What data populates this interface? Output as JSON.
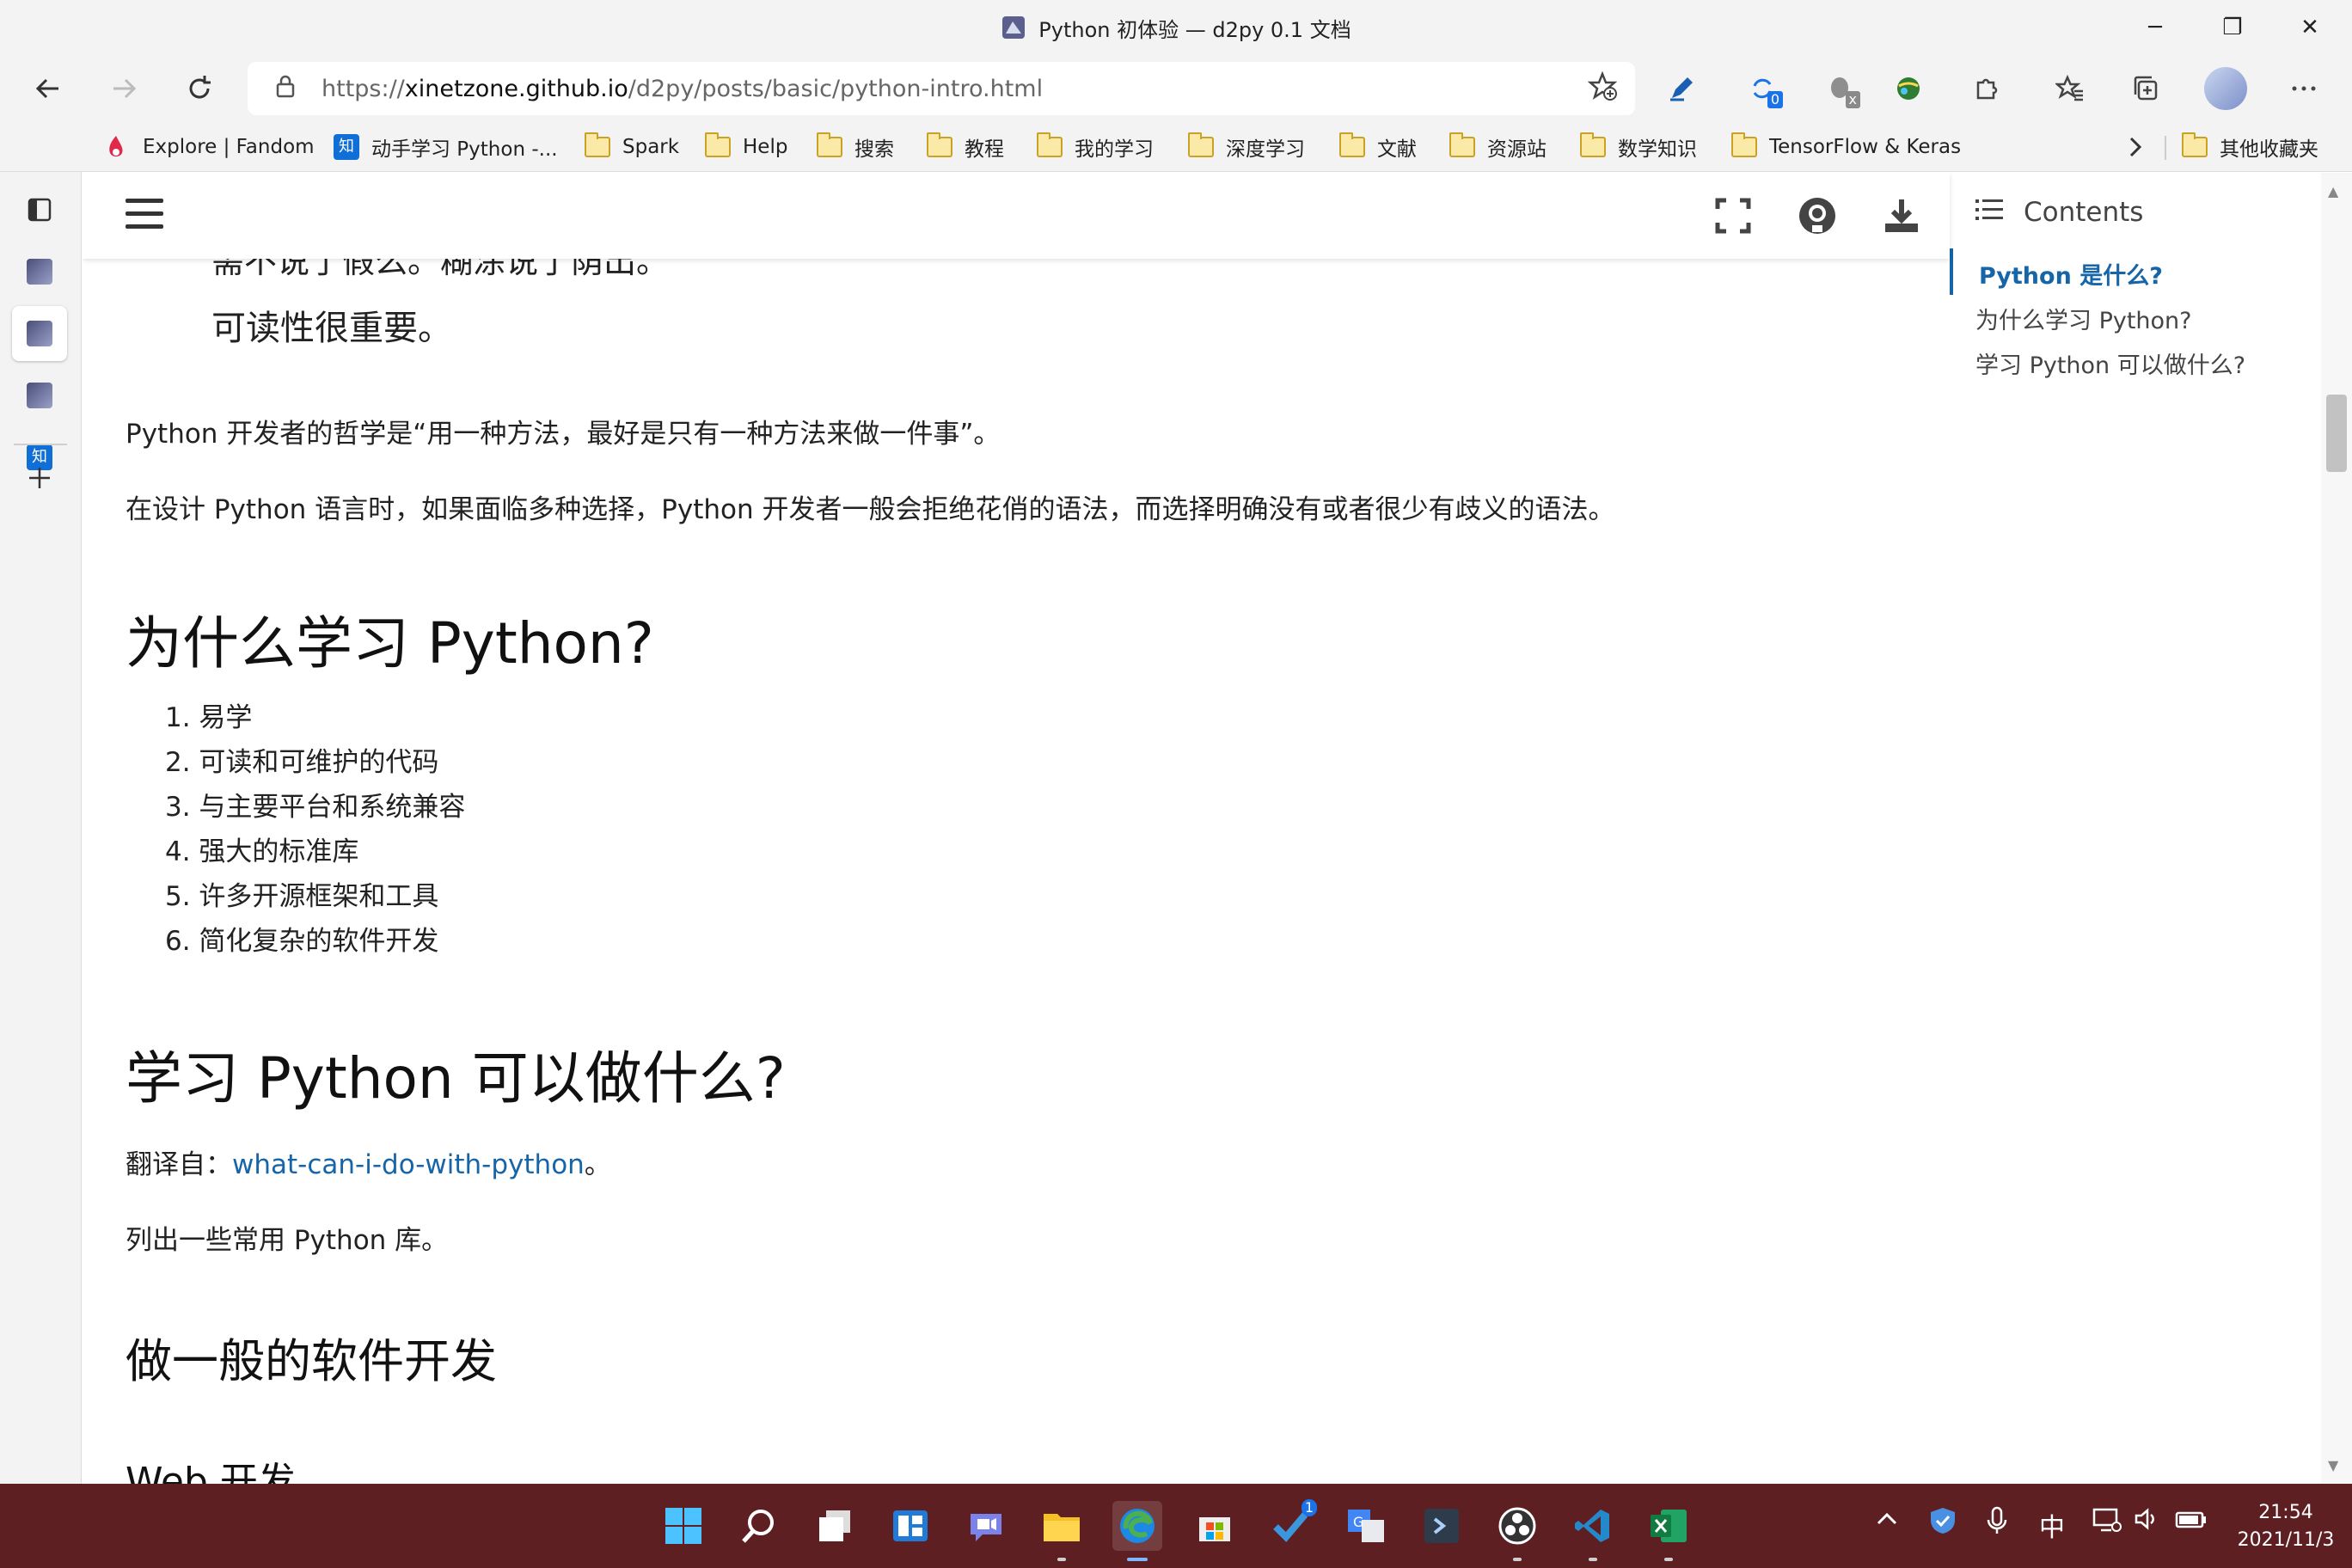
{
  "window": {
    "title": "Python 初体验 — d2py 0.1 文档",
    "minimize_glyph": "─",
    "restore_glyph": "❐",
    "close_glyph": "✕"
  },
  "toolbar": {
    "url_scheme": "https://",
    "url_host": "xinetzone.github.io",
    "url_path": "/d2py/posts/basic/python-intro.html",
    "collections_badge": "0",
    "extension_badge": "x"
  },
  "favorites": [
    {
      "label": "Explore | Fandom",
      "kind": "fandom"
    },
    {
      "label": "动手学习 Python -...",
      "kind": "zhi"
    },
    {
      "label": "Spark",
      "kind": "folder"
    },
    {
      "label": "Help",
      "kind": "folder"
    },
    {
      "label": "搜索",
      "kind": "folder"
    },
    {
      "label": "教程",
      "kind": "folder"
    },
    {
      "label": "我的学习",
      "kind": "folder"
    },
    {
      "label": "深度学习",
      "kind": "folder"
    },
    {
      "label": "文献",
      "kind": "folder"
    },
    {
      "label": "资源站",
      "kind": "folder"
    },
    {
      "label": "数学知识",
      "kind": "folder"
    },
    {
      "label": "TensorFlow & Keras",
      "kind": "folder"
    }
  ],
  "favorites_overflow": "其他收藏夹",
  "zhi_glyph": "知",
  "article": {
    "quote_cut": "需不说了假么。糊涂说了荫出。",
    "quote": "可读性很重要。",
    "para1": "Python 开发者的哲学是“用一种方法，最好是只有一种方法来做一件事”。",
    "para2": "在设计 Python 语言时，如果面临多种选择，Python 开发者一般会拒绝花俏的语法，而选择明确没有或者很少有歧义的语法。",
    "h2_why": "为什么学习 Python?",
    "reasons": [
      "1. 易学",
      "2. 可读和可维护的代码",
      "3. 与主要平台和系统兼容",
      "4. 强大的标准库",
      "5. 许多开源框架和工具",
      "6. 简化复杂的软件开发"
    ],
    "h2_what": "学习 Python 可以做什么?",
    "translated_from_label": "翻译自：",
    "translated_from_link": "what-can-i-do-with-python",
    "translated_from_end": "。",
    "para3": "列出一些常用 Python 库。",
    "h3_general": "做一般的软件开发",
    "h3_web": "Web 开发"
  },
  "toc": {
    "title": "Contents",
    "items": [
      "Python 是什么?",
      "为什么学习 Python?",
      "学习 Python 可以做什么?"
    ]
  },
  "taskbar": {
    "steam_badge": "1",
    "tray_ime": "中",
    "time": "21:54",
    "date": "2021/11/3"
  },
  "colors": {
    "link": "#1565a8",
    "taskbar": "#5e1f22",
    "chrome": "#f3f3f3"
  }
}
